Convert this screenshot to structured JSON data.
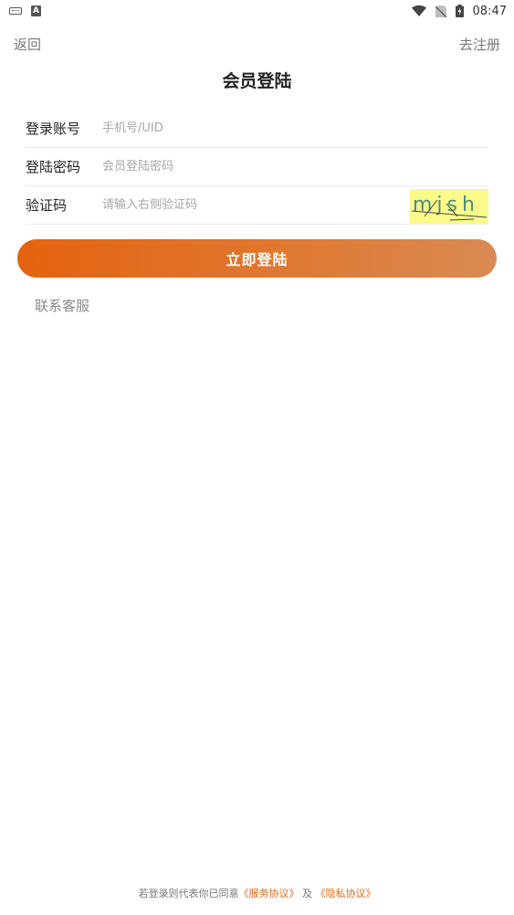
{
  "status_bar": {
    "time": "08:47",
    "icons": [
      "keyboard-icon",
      "a-badge-icon",
      "wifi-icon",
      "no-sim-icon",
      "battery-charging-icon"
    ],
    "a_badge": "A"
  },
  "header": {
    "back_label": "返回",
    "register_label": "去注册",
    "title": "会员登陆"
  },
  "form": {
    "account": {
      "label": "登录账号",
      "value": "",
      "placeholder": "手机号/UID"
    },
    "password": {
      "label": "登陆密码",
      "value": "",
      "placeholder": "会员登陆密码"
    },
    "captcha": {
      "label": "验证码",
      "value": "",
      "placeholder": "请输入右侧验证码",
      "image_text": "mjsh",
      "image_bg": "#fbfb8a"
    }
  },
  "login_button": {
    "label": "立即登陆",
    "color": "#e4620f"
  },
  "contact_label": "联系客服",
  "agreement": {
    "prefix": "若登录则代表你已同意",
    "terms_link": "《服务协议》",
    "conjunction": "及",
    "privacy_link": "《隐私协议》",
    "link_color": "#e36a1f"
  }
}
